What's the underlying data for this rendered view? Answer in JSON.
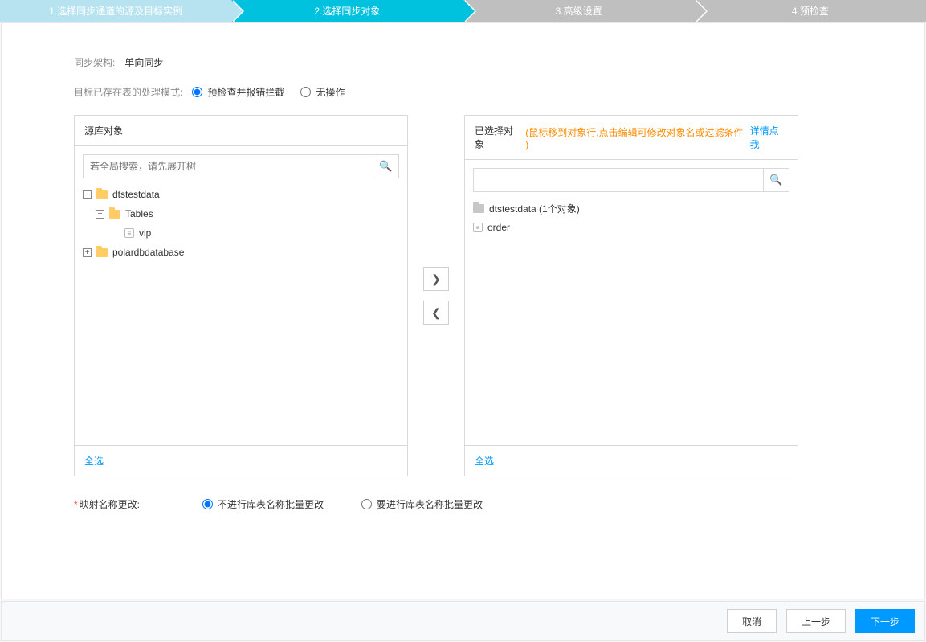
{
  "steps": [
    {
      "label": "1.选择同步通道的源及目标实例",
      "state": "done"
    },
    {
      "label": "2.选择同步对象",
      "state": "active"
    },
    {
      "label": "3.高级设置",
      "state": "gray"
    },
    {
      "label": "4.预检查",
      "state": "gray"
    }
  ],
  "sync_arch": {
    "label": "同步架构:",
    "value": "单向同步"
  },
  "existing_mode": {
    "label": "目标已存在表的处理模式:",
    "options": [
      {
        "label": "预检查并报错拦截",
        "selected": true
      },
      {
        "label": "无操作",
        "selected": false
      }
    ]
  },
  "source_box": {
    "title": "源库对象",
    "search_placeholder": "若全局搜索，请先展开树",
    "tree": [
      {
        "type": "db",
        "name": "dtstestdata",
        "expanded": true,
        "children": [
          {
            "type": "group",
            "name": "Tables",
            "expanded": true,
            "children": [
              {
                "type": "table",
                "name": "vip"
              }
            ]
          }
        ]
      },
      {
        "type": "db",
        "name": "polardbdatabase",
        "expanded": false
      }
    ],
    "select_all": "全选"
  },
  "target_box": {
    "title": "已选择对象",
    "hint": "(鼠标移到对象行,点击编辑可修改对象名或过滤条件 )",
    "hint_link": "详情点我",
    "items": [
      {
        "type": "db",
        "name": "dtstestdata (1个对象)"
      },
      {
        "type": "table",
        "name": "order"
      }
    ],
    "select_all": "全选"
  },
  "arrows": {
    "right": "❯",
    "left": "❮"
  },
  "mapping": {
    "label": "映射名称更改:",
    "options": [
      {
        "label": "不进行库表名称批量更改",
        "selected": true
      },
      {
        "label": "要进行库表名称批量更改",
        "selected": false
      }
    ]
  },
  "footer": {
    "cancel": "取消",
    "prev": "上一步",
    "next": "下一步"
  },
  "icons": {
    "search": "🔍",
    "file": "≡",
    "plus": "+",
    "minus": "−"
  }
}
